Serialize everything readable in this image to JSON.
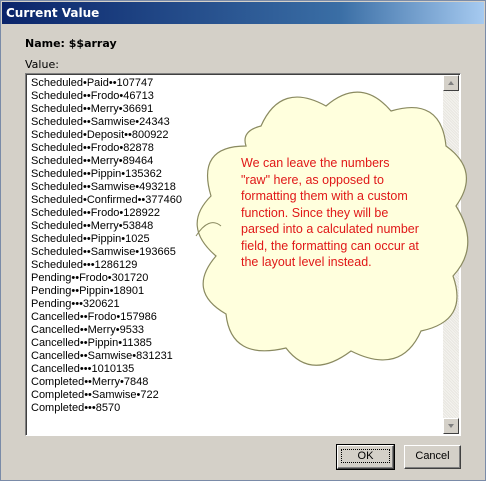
{
  "window": {
    "title": "Current Value",
    "name_text": "Name: $$array",
    "value_label": "Value:"
  },
  "list": {
    "lines": [
      "Scheduled•Paid••107747",
      "Scheduled••Frodo•46713",
      "Scheduled••Merry•36691",
      "Scheduled••Samwise•24343",
      "Scheduled•Deposit••800922",
      "Scheduled••Frodo•82878",
      "Scheduled••Merry•89464",
      "Scheduled••Pippin•135362",
      "Scheduled••Samwise•493218",
      "Scheduled•Confirmed••377460",
      "Scheduled••Frodo•128922",
      "Scheduled••Merry•53848",
      "Scheduled••Pippin•1025",
      "Scheduled••Samwise•193665",
      "Scheduled•••1286129",
      "Pending••Frodo•301720",
      "Pending••Pippin•18901",
      "Pending•••320621",
      "Cancelled••Frodo•157986",
      "Cancelled••Merry•9533",
      "Cancelled••Pippin•11385",
      "Cancelled••Samwise•831231",
      "Cancelled•••1010135",
      "Completed••Merry•7848",
      "Completed••Samwise•722",
      "Completed•••8570"
    ]
  },
  "callout": {
    "text": "We can leave the numbers \"raw\" here, as opposed to formatting them with a custom function. Since they will be parsed into a calculated number field, the formatting can occur at the layout level instead.",
    "text_color": "#e01818",
    "fill_color": "#ffffdd"
  },
  "buttons": {
    "ok_label": "OK",
    "cancel_label": "Cancel"
  }
}
